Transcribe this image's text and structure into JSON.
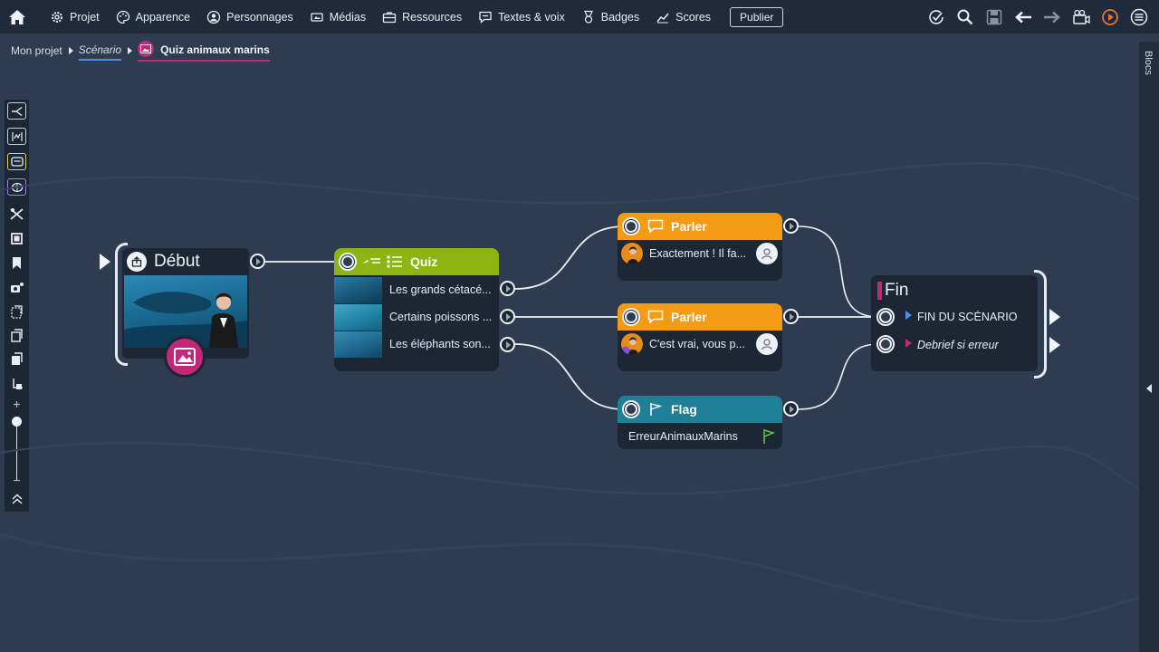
{
  "menu": {
    "items": [
      {
        "label": "Projet",
        "icon": "gear-icon"
      },
      {
        "label": "Apparence",
        "icon": "palette-icon"
      },
      {
        "label": "Personnages",
        "icon": "person-icon"
      },
      {
        "label": "Médias",
        "icon": "media-icon"
      },
      {
        "label": "Ressources",
        "icon": "briefcase-icon"
      },
      {
        "label": "Textes & voix",
        "icon": "speech-icon"
      },
      {
        "label": "Badges",
        "icon": "badge-icon"
      },
      {
        "label": "Scores",
        "icon": "chart-icon"
      }
    ],
    "publish_label": "Publier"
  },
  "breadcrumb": {
    "project": "Mon projet",
    "scenario": "Scénario",
    "current": "Quiz animaux marins"
  },
  "side_panel": {
    "label": "Blocs"
  },
  "nodes": {
    "start": {
      "title": "Début"
    },
    "quiz": {
      "title": "Quiz",
      "answers": [
        "Les grands cétacé...",
        "Certains poissons ...",
        "Les éléphants son..."
      ]
    },
    "speak1": {
      "title": "Parler",
      "text": "Exactement ! Il fa..."
    },
    "speak2": {
      "title": "Parler",
      "text": "C'est vrai, vous p..."
    },
    "flag": {
      "title": "Flag",
      "text": "ErreurAnimauxMarins"
    },
    "end": {
      "title": "Fin",
      "outputs": [
        "FIN DU SCÉNARIO",
        "Debrief si erreur"
      ]
    }
  },
  "colors": {
    "quiz_header": "#8cb514",
    "speak_header": "#f59a13",
    "flag_header": "#1e7f97",
    "media_accent": "#c2287a",
    "end_output_1": "#4a90e2",
    "end_output_2": "#c2287a"
  }
}
